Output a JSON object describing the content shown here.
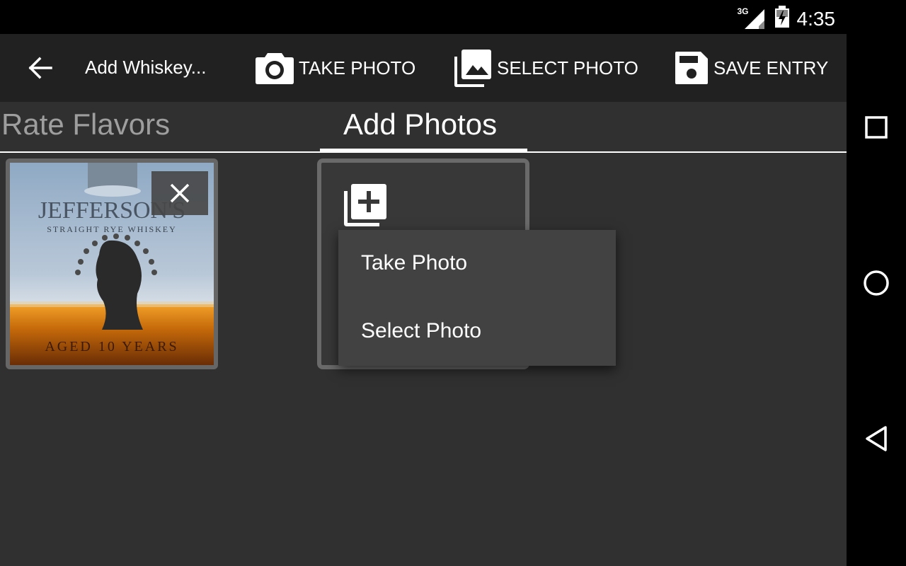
{
  "status": {
    "network": "3G",
    "time": "4:35"
  },
  "toolbar": {
    "title": "Add Whiskey...",
    "take_photo_label": "TAKE PHOTO",
    "select_photo_label": "SELECT PHOTO",
    "save_entry_label": "SAVE ENTRY"
  },
  "tabs": [
    {
      "label": "Rate Flavors",
      "active": false
    },
    {
      "label": "Add Photos",
      "active": true
    }
  ],
  "photo": {
    "bottle_brand": "JEFFERSON'S",
    "bottle_subtitle": "STRAIGHT RYE WHISKEY",
    "bottle_age": "AGED 10 YEARS"
  },
  "popup_menu": {
    "items": [
      {
        "label": "Take Photo"
      },
      {
        "label": "Select Photo"
      }
    ]
  },
  "colors": {
    "background": "#303030",
    "toolbar": "#212121",
    "popup": "#424242",
    "inactive_tab": "#9e9e9e"
  }
}
